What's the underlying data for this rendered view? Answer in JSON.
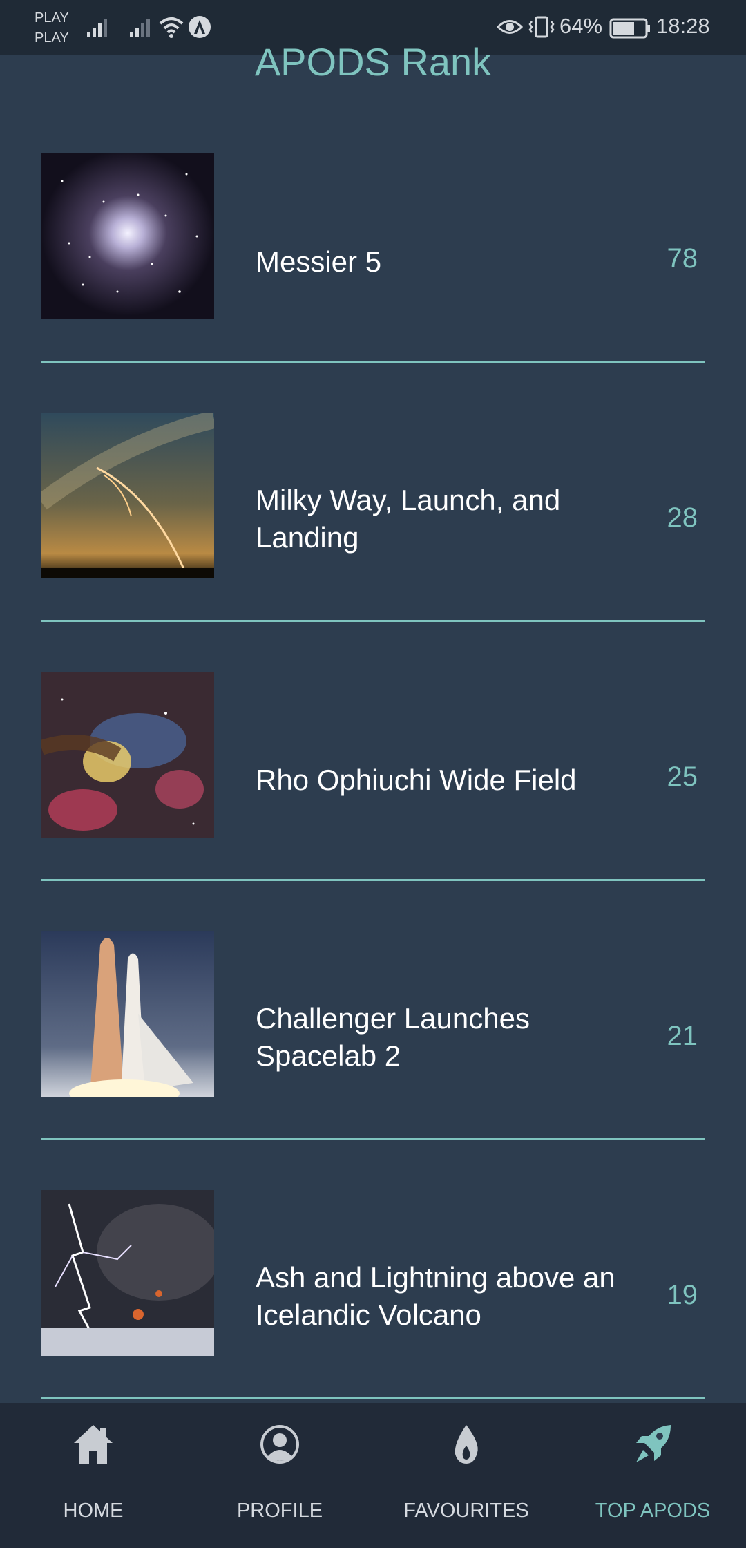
{
  "status_bar": {
    "carrier_1": "PLAY",
    "carrier_2": "PLAY",
    "battery": "64%",
    "time": "18:28"
  },
  "header": {
    "title": "APODS Rank"
  },
  "rank_items": [
    {
      "title": "Messier 5",
      "count": "78",
      "image": "globular-cluster-image"
    },
    {
      "title": "Milky Way, Launch, and\nLanding",
      "count": "28",
      "image": "milky-way-launch-image"
    },
    {
      "title": "Rho Ophiuchi Wide Field",
      "count": "25",
      "image": "nebula-image"
    },
    {
      "title": "Challenger Launches\nSpacelab 2",
      "count": "21",
      "image": "shuttle-launch-image"
    },
    {
      "title": "Ash and Lightning above an\nIcelandic Volcano",
      "count": "19",
      "image": "volcano-lightning-image"
    }
  ],
  "bottom_nav": {
    "items": [
      {
        "label": "HOME",
        "icon": "home-icon",
        "active": false
      },
      {
        "label": "PROFILE",
        "icon": "profile-icon",
        "active": false
      },
      {
        "label": "FAVOURITES",
        "icon": "flame-icon",
        "active": false
      },
      {
        "label": "TOP APODS",
        "icon": "rocket-icon",
        "active": true
      }
    ]
  },
  "colors": {
    "background": "#2d3d4f",
    "accent": "#7fc4bf",
    "nav_background": "#212a38"
  }
}
